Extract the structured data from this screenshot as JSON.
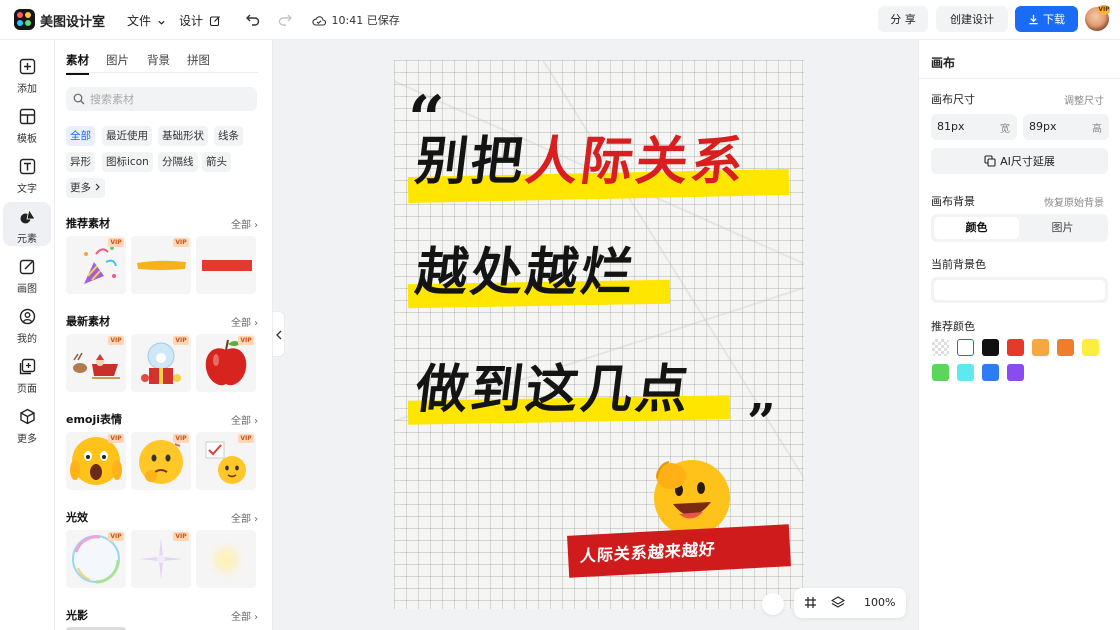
{
  "app": {
    "name": "美图设计室",
    "save_status": "10:41 已保存"
  },
  "topbar": {
    "menus": [
      "文件",
      "设计"
    ],
    "share_label": "分 享",
    "create_label": "创建设计",
    "download_label": "下载",
    "avatar_badge": "VIP"
  },
  "rail": {
    "items": [
      {
        "label": "添加",
        "icon": "plus-square-icon"
      },
      {
        "label": "模板",
        "icon": "template-icon"
      },
      {
        "label": "文字",
        "icon": "text-icon"
      },
      {
        "label": "元素",
        "icon": "shapes-icon"
      },
      {
        "label": "画图",
        "icon": "pencil-icon"
      },
      {
        "label": "我的",
        "icon": "user-icon"
      },
      {
        "label": "页面",
        "icon": "add-page-icon"
      },
      {
        "label": "更多",
        "icon": "cube-icon"
      }
    ],
    "active_index": 3
  },
  "panel": {
    "tabs": [
      "素材",
      "图片",
      "背景",
      "拼图"
    ],
    "search_placeholder": "搜索素材",
    "chips": [
      "全部",
      "最近使用",
      "基础形状",
      "线条",
      "异形",
      "图标icon",
      "分隔线",
      "箭头",
      "更多"
    ],
    "more_label": "全部",
    "vip_label": "VIP",
    "sections": [
      {
        "title": "推荐素材",
        "thumbs": [
          "party-popper",
          "yellow-brush-stroke",
          "red-bar"
        ]
      },
      {
        "title": "最新素材",
        "thumbs": [
          "reindeer-sleigh",
          "snow-globe-gift",
          "red-apple"
        ]
      },
      {
        "title": "emoji表情",
        "thumbs": [
          "shocked-face",
          "thinking-face",
          "sign-face"
        ]
      },
      {
        "title": "光效",
        "thumbs": [
          "rainbow-bubble",
          "star-sparkle",
          "soft-glow"
        ]
      },
      {
        "title": "光影",
        "thumbs": []
      }
    ]
  },
  "canvas": {
    "quote_open": "“",
    "quote_close": "”",
    "line1_prefix": "别把",
    "line1_highlight": "人际关系",
    "line2": "越处越烂",
    "line3": "做到这几点",
    "banner_text": "人际关系越来越好",
    "colors": {
      "highlight": "#ffe600",
      "accent": "#d81e1e",
      "text": "#141414"
    }
  },
  "zoom": {
    "value": "100%"
  },
  "right_panel": {
    "title": "画布",
    "size_label": "画布尺寸",
    "size_action": "调整尺寸",
    "width_value": "81px",
    "width_unit": "宽",
    "height_value": "89px",
    "height_unit": "高",
    "ai_extend_label": "AI尺寸延展",
    "bg_label": "画布背景",
    "bg_reset": "恢复原始背景",
    "bg_tabs": [
      "颜色",
      "图片"
    ],
    "current_color_label": "当前背景色",
    "current_color": "#ffffff",
    "recommended_label": "推荐颜色",
    "swatches": [
      "transparent",
      "#ffffff",
      "#111111",
      "#e53a2a",
      "#f5a742",
      "#f07d2c",
      "#fbee3f",
      "#5bd55b",
      "#5ee9ee",
      "#2d7cf0",
      "#8a4cf0"
    ]
  }
}
